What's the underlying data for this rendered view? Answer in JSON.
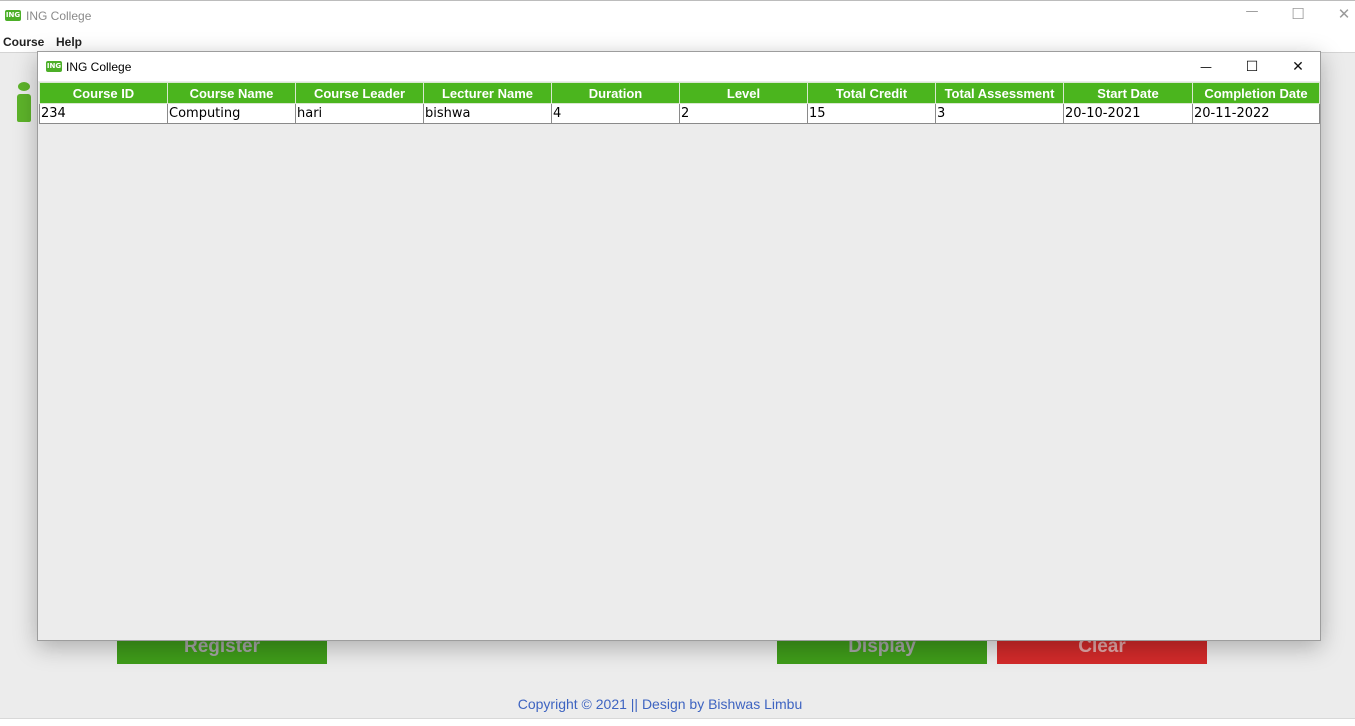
{
  "main_window": {
    "title": "ING College",
    "icon": "ing-college-logo",
    "icon_text": "ING",
    "controls": {
      "minimize": "—",
      "maximize": "☐",
      "close": "✕"
    }
  },
  "menubar": {
    "items": [
      {
        "label": "Course"
      },
      {
        "label": "Help"
      }
    ]
  },
  "main_buttons": {
    "register": "Register",
    "display": "Display",
    "clear": "Clear"
  },
  "footer": {
    "copyright": "Copyright © 2021 || Design by Bishwas Limbu"
  },
  "dialog": {
    "title": "ING College",
    "icon_text": "ING",
    "controls": {
      "minimize": "—",
      "maximize": "☐",
      "close": "✕"
    }
  },
  "table": {
    "columns": [
      "Course ID",
      "Course Name",
      "Course Leader",
      "Lecturer Name",
      "Duration",
      "Level",
      "Total Credit",
      "Total Assessment",
      "Start Date",
      "Completion Date"
    ],
    "rows": [
      [
        "234",
        "Computing",
        "hari",
        "bishwa",
        "4",
        "2",
        "15",
        "3",
        "20-10-2021",
        "20-11-2022"
      ]
    ]
  },
  "colors": {
    "header_green": "#4bb51e",
    "register_green": "#3f9c1a",
    "clear_red": "#d32a2a",
    "copyright_blue": "#3e64c1"
  }
}
